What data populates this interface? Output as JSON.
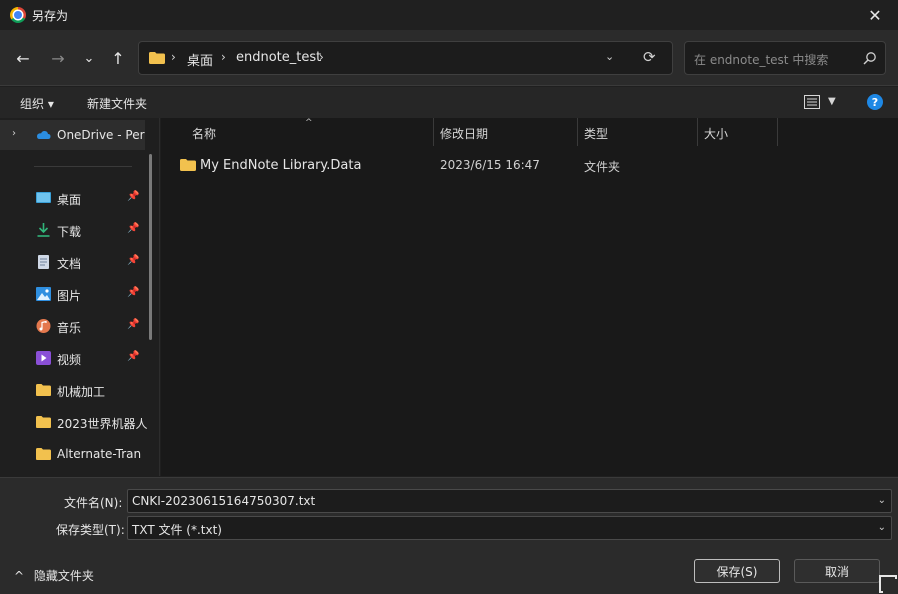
{
  "window": {
    "title": "另存为",
    "close_label": "✕"
  },
  "nav": {
    "back": "←",
    "forward": "→",
    "recent": "⌄",
    "up": "↑",
    "breadcrumb": [
      "桌面",
      "endnote_test"
    ],
    "search_placeholder": "在 endnote_test 中搜索"
  },
  "toolbar": {
    "organize": "组织 ▾",
    "new_folder": "新建文件夹",
    "help": "?"
  },
  "sidebar": {
    "onedrive": "OneDrive - Per",
    "items": [
      {
        "label": "桌面",
        "icon": "desktop-icon",
        "pinned": true
      },
      {
        "label": "下载",
        "icon": "download-icon",
        "pinned": true
      },
      {
        "label": "文档",
        "icon": "document-icon",
        "pinned": true
      },
      {
        "label": "图片",
        "icon": "pictures-icon",
        "pinned": true
      },
      {
        "label": "音乐",
        "icon": "music-icon",
        "pinned": true
      },
      {
        "label": "视频",
        "icon": "video-icon",
        "pinned": true
      },
      {
        "label": "机械加工",
        "icon": "folder-icon",
        "pinned": false
      },
      {
        "label": "2023世界机器人",
        "icon": "folder-icon",
        "pinned": false
      },
      {
        "label": "Alternate-Tran",
        "icon": "folder-icon",
        "pinned": false
      }
    ]
  },
  "columns": {
    "name": "名称",
    "modified": "修改日期",
    "type": "类型",
    "size": "大小"
  },
  "files": [
    {
      "name": "My EndNote Library.Data",
      "modified": "2023/6/15 16:47",
      "type": "文件夹",
      "size": ""
    }
  ],
  "form": {
    "filename_label": "文件名(N):",
    "filename_value": "CNKI-20230615164750307.txt",
    "filetype_label": "保存类型(T):",
    "filetype_value": "TXT 文件 (*.txt)"
  },
  "footer": {
    "hide_folders": "隐藏文件夹",
    "save": "保存(S)",
    "cancel": "取消"
  },
  "colors": {
    "folder": "#f2c14e",
    "accent": "#1e88e5"
  }
}
